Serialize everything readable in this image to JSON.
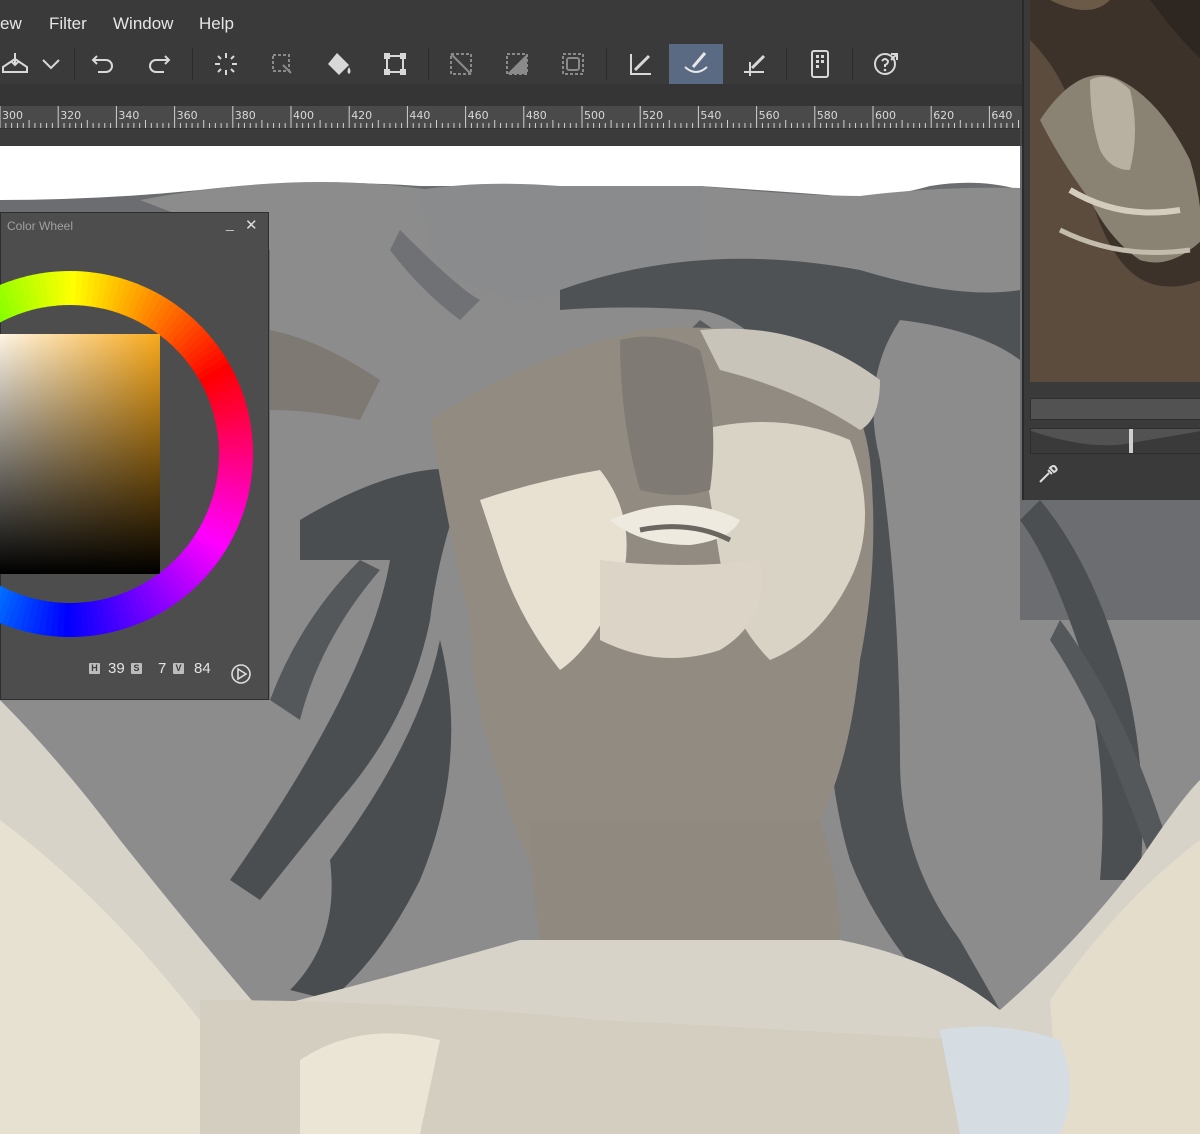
{
  "menubar": {
    "items": [
      "ew",
      "Filter",
      "Window",
      "Help"
    ]
  },
  "toolbar": {
    "buttons": [
      "save-icon",
      "dropdown-chevron-icon",
      "undo-icon",
      "redo-icon",
      "clear-icon",
      "deselect-icon",
      "fill-icon",
      "transform-icon",
      "crop-icon",
      "invert-selection-icon",
      "selection-border-icon",
      "pen-icon",
      "brush-icon",
      "ruler-pen-icon",
      "device-icon",
      "help-icon"
    ],
    "active": "brush-icon"
  },
  "ruler": {
    "labels": [
      "300",
      "320",
      "340",
      "360",
      "380",
      "400",
      "420",
      "440",
      "460",
      "480",
      "500",
      "520",
      "540",
      "560",
      "580",
      "600",
      "620",
      "640"
    ]
  },
  "color_wheel": {
    "title": "Color Wheel",
    "h_label": "H",
    "h_value": "39",
    "s_label": "S",
    "s_value": "7",
    "v_label": "V",
    "v_value": "84",
    "square_color": "#f9a91a"
  },
  "colors": {
    "ui_bg": "#3a3a3a",
    "active_tool": "#5a6a83",
    "canvas_white": "#ffffff"
  }
}
